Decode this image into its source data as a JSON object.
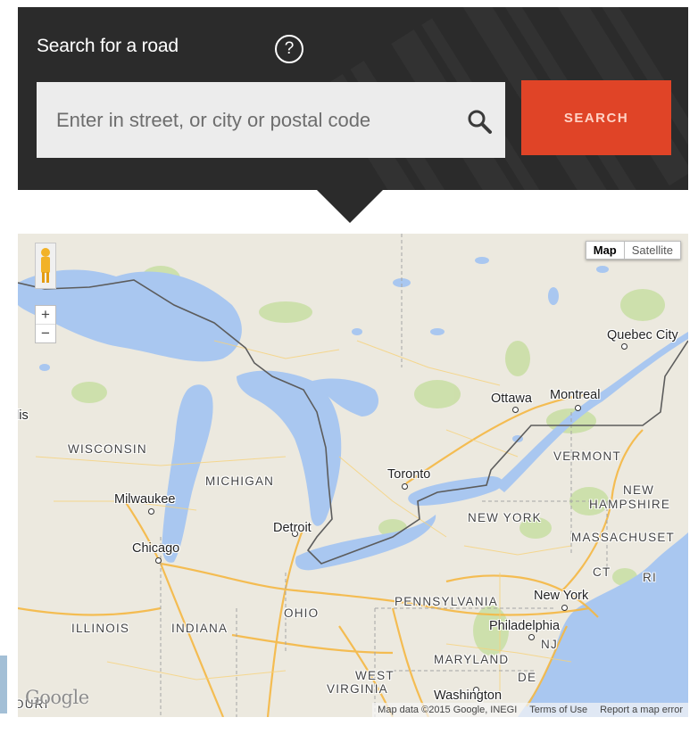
{
  "search": {
    "title": "Search for a road",
    "help_symbol": "?",
    "placeholder": "Enter in street, or city or postal code",
    "value": "",
    "button_label": "SEARCH",
    "icons": {
      "help": "question-circle-icon",
      "search": "magnifier-icon"
    }
  },
  "map": {
    "type_controls": {
      "map": "Map",
      "satellite": "Satellite",
      "selected": "Map"
    },
    "zoom": {
      "in": "+",
      "out": "−"
    },
    "attribution": "Map data ©2015 Google, INEGI",
    "terms": "Terms of Use",
    "report": "Report a map error",
    "logo": "Google",
    "labels": {
      "quebec_city": "Quebec City",
      "ottawa": "Ottawa",
      "montreal": "Montreal",
      "toronto": "Toronto",
      "milwaukee": "Milwaukee",
      "chicago": "Chicago",
      "detroit": "Detroit",
      "new_york": "New York",
      "philadelphia": "Philadelphia",
      "washington": "Washington",
      "wisconsin": "WISCONSIN",
      "michigan": "MICHIGAN",
      "vermont": "VERMONT",
      "new_hampshire_1": "NEW",
      "new_hampshire_2": "HAMPSHIRE",
      "new_york_state": "NEW YORK",
      "massachusetts": "MASSACHUSET",
      "ct": "CT",
      "ri": "RI",
      "pennsylvania": "PENNSYLVANIA",
      "nj": "NJ",
      "ohio": "OHIO",
      "illinois": "ILLINOIS",
      "indiana": "INDIANA",
      "maryland": "MARYLAND",
      "de": "DE",
      "west_virginia_1": "WEST",
      "west_virginia_2": "VIRGINIA",
      "edge_left": "lis",
      "edge_bottom": "OURI"
    },
    "colors": {
      "water": "#a9c7f0",
      "land": "#ece9df",
      "park": "#c7df9f",
      "road": "#f5b843",
      "border": "#5c5c5c"
    }
  }
}
